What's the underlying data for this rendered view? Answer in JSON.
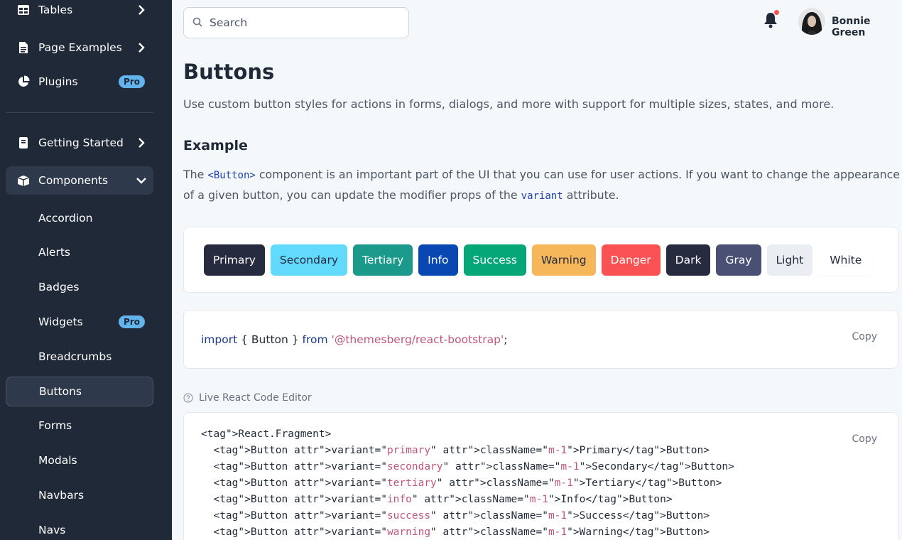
{
  "sidebar": {
    "top_items": [
      {
        "label": "Tables",
        "icon": "table-icon",
        "has_chevron": true
      },
      {
        "label": "Page Examples",
        "icon": "document-icon",
        "has_chevron": true
      },
      {
        "label": "Plugins",
        "icon": "pie-chart-icon",
        "badge": "Pro"
      }
    ],
    "items": [
      {
        "label": "Getting Started",
        "icon": "book-icon",
        "has_chevron": true
      },
      {
        "label": "Components",
        "icon": "box-icon",
        "expanded": true
      }
    ],
    "sub_items": [
      {
        "label": "Accordion"
      },
      {
        "label": "Alerts"
      },
      {
        "label": "Badges"
      },
      {
        "label": "Widgets",
        "badge": "Pro"
      },
      {
        "label": "Breadcrumbs"
      },
      {
        "label": "Buttons",
        "active": true
      },
      {
        "label": "Forms"
      },
      {
        "label": "Modals"
      },
      {
        "label": "Navbars"
      },
      {
        "label": "Navs"
      }
    ]
  },
  "header": {
    "search_placeholder": "Search",
    "user_name": "Bonnie Green"
  },
  "main": {
    "title": "Buttons",
    "description": "Use custom button styles for actions in forms, dialogs, and more with support for multiple sizes, states, and more.",
    "section_title": "Example",
    "para_1": "The ",
    "para_code_1": "<Button>",
    "para_2": " component is an important part of the UI that you can use for user actions. If you want to change the appearance of a given button, you can update the modifier props of the ",
    "para_code_2": "variant",
    "para_3": " attribute.",
    "buttons": [
      {
        "label": "Primary",
        "bg": "#262b40",
        "fg": "#ffffff"
      },
      {
        "label": "Secondary",
        "bg": "#61dafb",
        "fg": "#262b40"
      },
      {
        "label": "Tertiary",
        "bg": "#1b998b",
        "fg": "#ffffff"
      },
      {
        "label": "Info",
        "bg": "#0948b3",
        "fg": "#ffffff"
      },
      {
        "label": "Success",
        "bg": "#05a677",
        "fg": "#ffffff"
      },
      {
        "label": "Warning",
        "bg": "#f5b759",
        "fg": "#262b40"
      },
      {
        "label": "Danger",
        "bg": "#fa5252",
        "fg": "#ffffff"
      },
      {
        "label": "Dark",
        "bg": "#262b40",
        "fg": "#ffffff"
      },
      {
        "label": "Gray",
        "bg": "#4a5073",
        "fg": "#ffffff"
      },
      {
        "label": "Light",
        "bg": "#eaedf2",
        "fg": "#262b40"
      },
      {
        "label": "White",
        "bg": "#ffffff",
        "fg": "#262b40"
      }
    ],
    "import_code": {
      "kw_import": "import",
      "middle": " { Button } ",
      "kw_from": "from",
      "space": " ",
      "module": "'@themesberg/react-bootstrap'",
      "semi": ";"
    },
    "copy_label": "Copy",
    "live_editor_label": "Live React Code Editor",
    "code_lines": [
      "<React.Fragment>",
      "  <Button variant=\"primary\" className=\"m-1\">Primary</Button>",
      "  <Button variant=\"secondary\" className=\"m-1\">Secondary</Button>",
      "  <Button variant=\"tertiary\" className=\"m-1\">Tertiary</Button>",
      "  <Button variant=\"info\" className=\"m-1\">Info</Button>",
      "  <Button variant=\"success\" className=\"m-1\">Success</Button>",
      "  <Button variant=\"warning\" className=\"m-1\">Warning</Button>"
    ],
    "code_variants": [
      "primary",
      "secondary",
      "tertiary",
      "info",
      "success",
      "warning"
    ],
    "code_labels": [
      "Primary",
      "Secondary",
      "Tertiary",
      "Info",
      "Success",
      "Warning"
    ]
  }
}
